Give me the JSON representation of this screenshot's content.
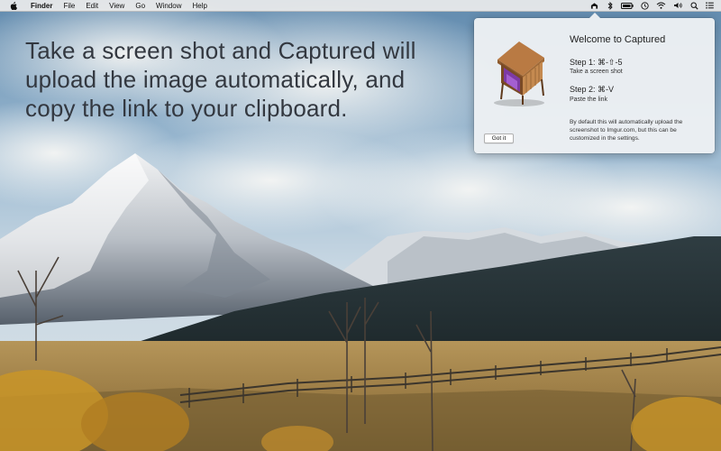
{
  "menubar": {
    "apple_icon": "apple-logo-icon",
    "items": [
      {
        "label": "Finder"
      },
      {
        "label": "File"
      },
      {
        "label": "Edit"
      },
      {
        "label": "View"
      },
      {
        "label": "Go"
      },
      {
        "label": "Window"
      },
      {
        "label": "Help"
      }
    ],
    "status_icons": [
      "captured-app-icon",
      "bluetooth-icon",
      "battery-icon",
      "time-machine-icon",
      "wifi-icon",
      "volume-icon",
      "spotlight-search-icon",
      "notification-center-icon"
    ]
  },
  "headline": {
    "text": "Take a screen shot and Captured will upload the image automatically, and copy the link to your clipboard."
  },
  "popover": {
    "title": "Welcome to Captured",
    "step1_title": "Step 1: ⌘-⇧-5",
    "step1_desc": "Take a screen shot",
    "step2_title": "Step 2: ⌘-V",
    "step2_desc": "Paste the link",
    "note": "By default this will automatically upload the screenshot to Imgur.com, but this can be customized in the settings.",
    "button_label": "Got it"
  },
  "colors": {
    "headline": "#333840",
    "popover_bg": "#ecf0f3",
    "menubar_bg": "#ececec"
  }
}
